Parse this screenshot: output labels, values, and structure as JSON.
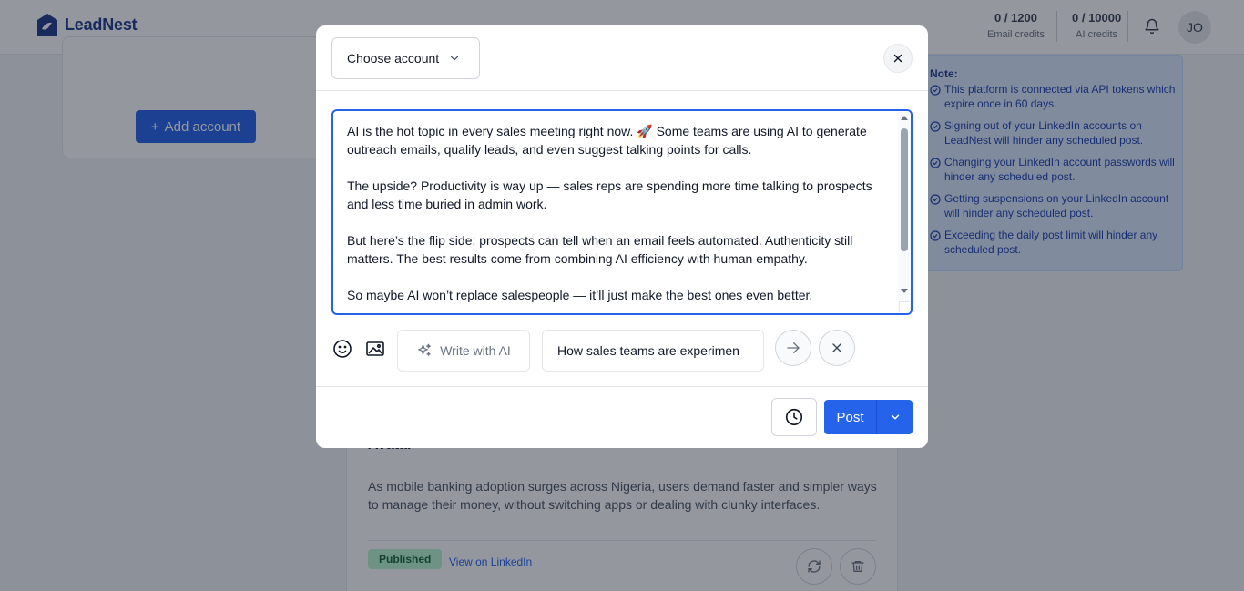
{
  "header": {
    "logo_text": "LeadNest",
    "email_credits_value": "0 / 1200",
    "email_credits_label": "Email credits",
    "ai_credits_value": "0 / 10000",
    "ai_credits_label": "AI credits",
    "avatar_initials": "JO"
  },
  "background": {
    "add_account_label": "Add account",
    "note": {
      "title": "Note:",
      "items": [
        "This platform is connected via API tokens which expire once in 60 days.",
        "Signing out of your LinkedIn accounts on LeadNest will hinder any scheduled post.",
        "Changing your LinkedIn account passwords will hinder any scheduled post.",
        "Getting suspensions on your LinkedIn account will hinder any scheduled post.",
        "Exceeding the daily post limit will hinder any scheduled post."
      ]
    },
    "post_card": {
      "heading": "Avatar",
      "body": "As mobile banking adoption surges across Nigeria, users demand faster and simpler ways to manage their money, without switching apps or dealing with clunky interfaces.",
      "status": "Published",
      "view_link": "View on LinkedIn"
    }
  },
  "modal": {
    "choose_account_label": "Choose account",
    "post_text": "AI is the hot topic in every sales meeting right now. 🚀 Some teams are using AI to generate outreach emails, qualify leads, and even suggest talking points for calls.\n\nThe upside? Productivity is way up — sales reps are spending more time talking to prospects and less time buried in admin work.\n\nBut here’s the flip side: prospects can tell when an email feels automated. Authenticity still matters. The best results come from combining AI efficiency with human empathy.\n\nSo maybe AI won’t replace salespeople — it’ll just make the best ones even better.",
    "write_with_ai_label": "Write with AI",
    "ai_prompt_value": "How sales teams are experimen",
    "post_button_label": "Post"
  },
  "colors": {
    "primary": "#2563eb",
    "note_bg": "#dbeafe",
    "published_bg": "#bbf7d0"
  }
}
